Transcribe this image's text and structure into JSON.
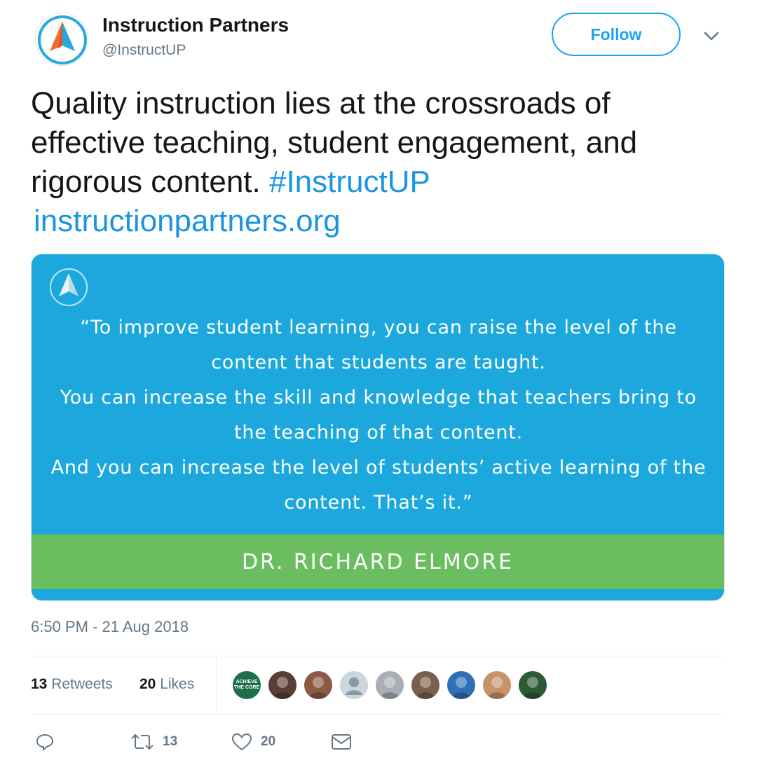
{
  "account": {
    "name": "Instruction Partners",
    "handle": "@InstructUP",
    "follow_label": "Follow"
  },
  "tweet": {
    "text": "Quality instruction lies at the crossroads of effective teaching, student engagement, and rigorous content.",
    "hashtag": "#InstructUP",
    "link": "instructionpartners.org",
    "timestamp": "6:50 PM - 21 Aug 2018"
  },
  "card": {
    "quote_lines": [
      "“To improve student learning, you can raise the level of the",
      "content that students are taught.",
      "You can increase the skill and knowledge that teachers bring to",
      "the teaching of that content.",
      "And you can increase the level of students’ active learning of the",
      "content. That’s it.”"
    ],
    "author": "DR. RICHARD ELMORE",
    "colors": {
      "background": "#1ca8dd",
      "band": "#6abe5f"
    }
  },
  "stats": {
    "retweets_count": "13",
    "retweets_label": "Retweets",
    "likes_count": "20",
    "likes_label": "Likes",
    "likers": [
      {
        "name": "achieve-the-core",
        "text": "ACHIEVE THE CORE",
        "color": "#1f6e4b"
      },
      {
        "name": "liker-2",
        "color": "#5a3d35"
      },
      {
        "name": "liker-3",
        "color": "#8a5a44"
      },
      {
        "name": "liker-default",
        "color": "#ccd6dd"
      },
      {
        "name": "liker-5",
        "color": "#a9aeb5"
      },
      {
        "name": "liker-6",
        "color": "#7a5f4c"
      },
      {
        "name": "liker-7",
        "color": "#2f6fb6"
      },
      {
        "name": "liker-8",
        "color": "#c7946a"
      },
      {
        "name": "liker-9",
        "color": "#2b5a34"
      }
    ]
  },
  "actions": {
    "retweet_count": "13",
    "like_count": "20"
  },
  "colors": {
    "accent": "#1da1f2",
    "muted": "#657786"
  }
}
